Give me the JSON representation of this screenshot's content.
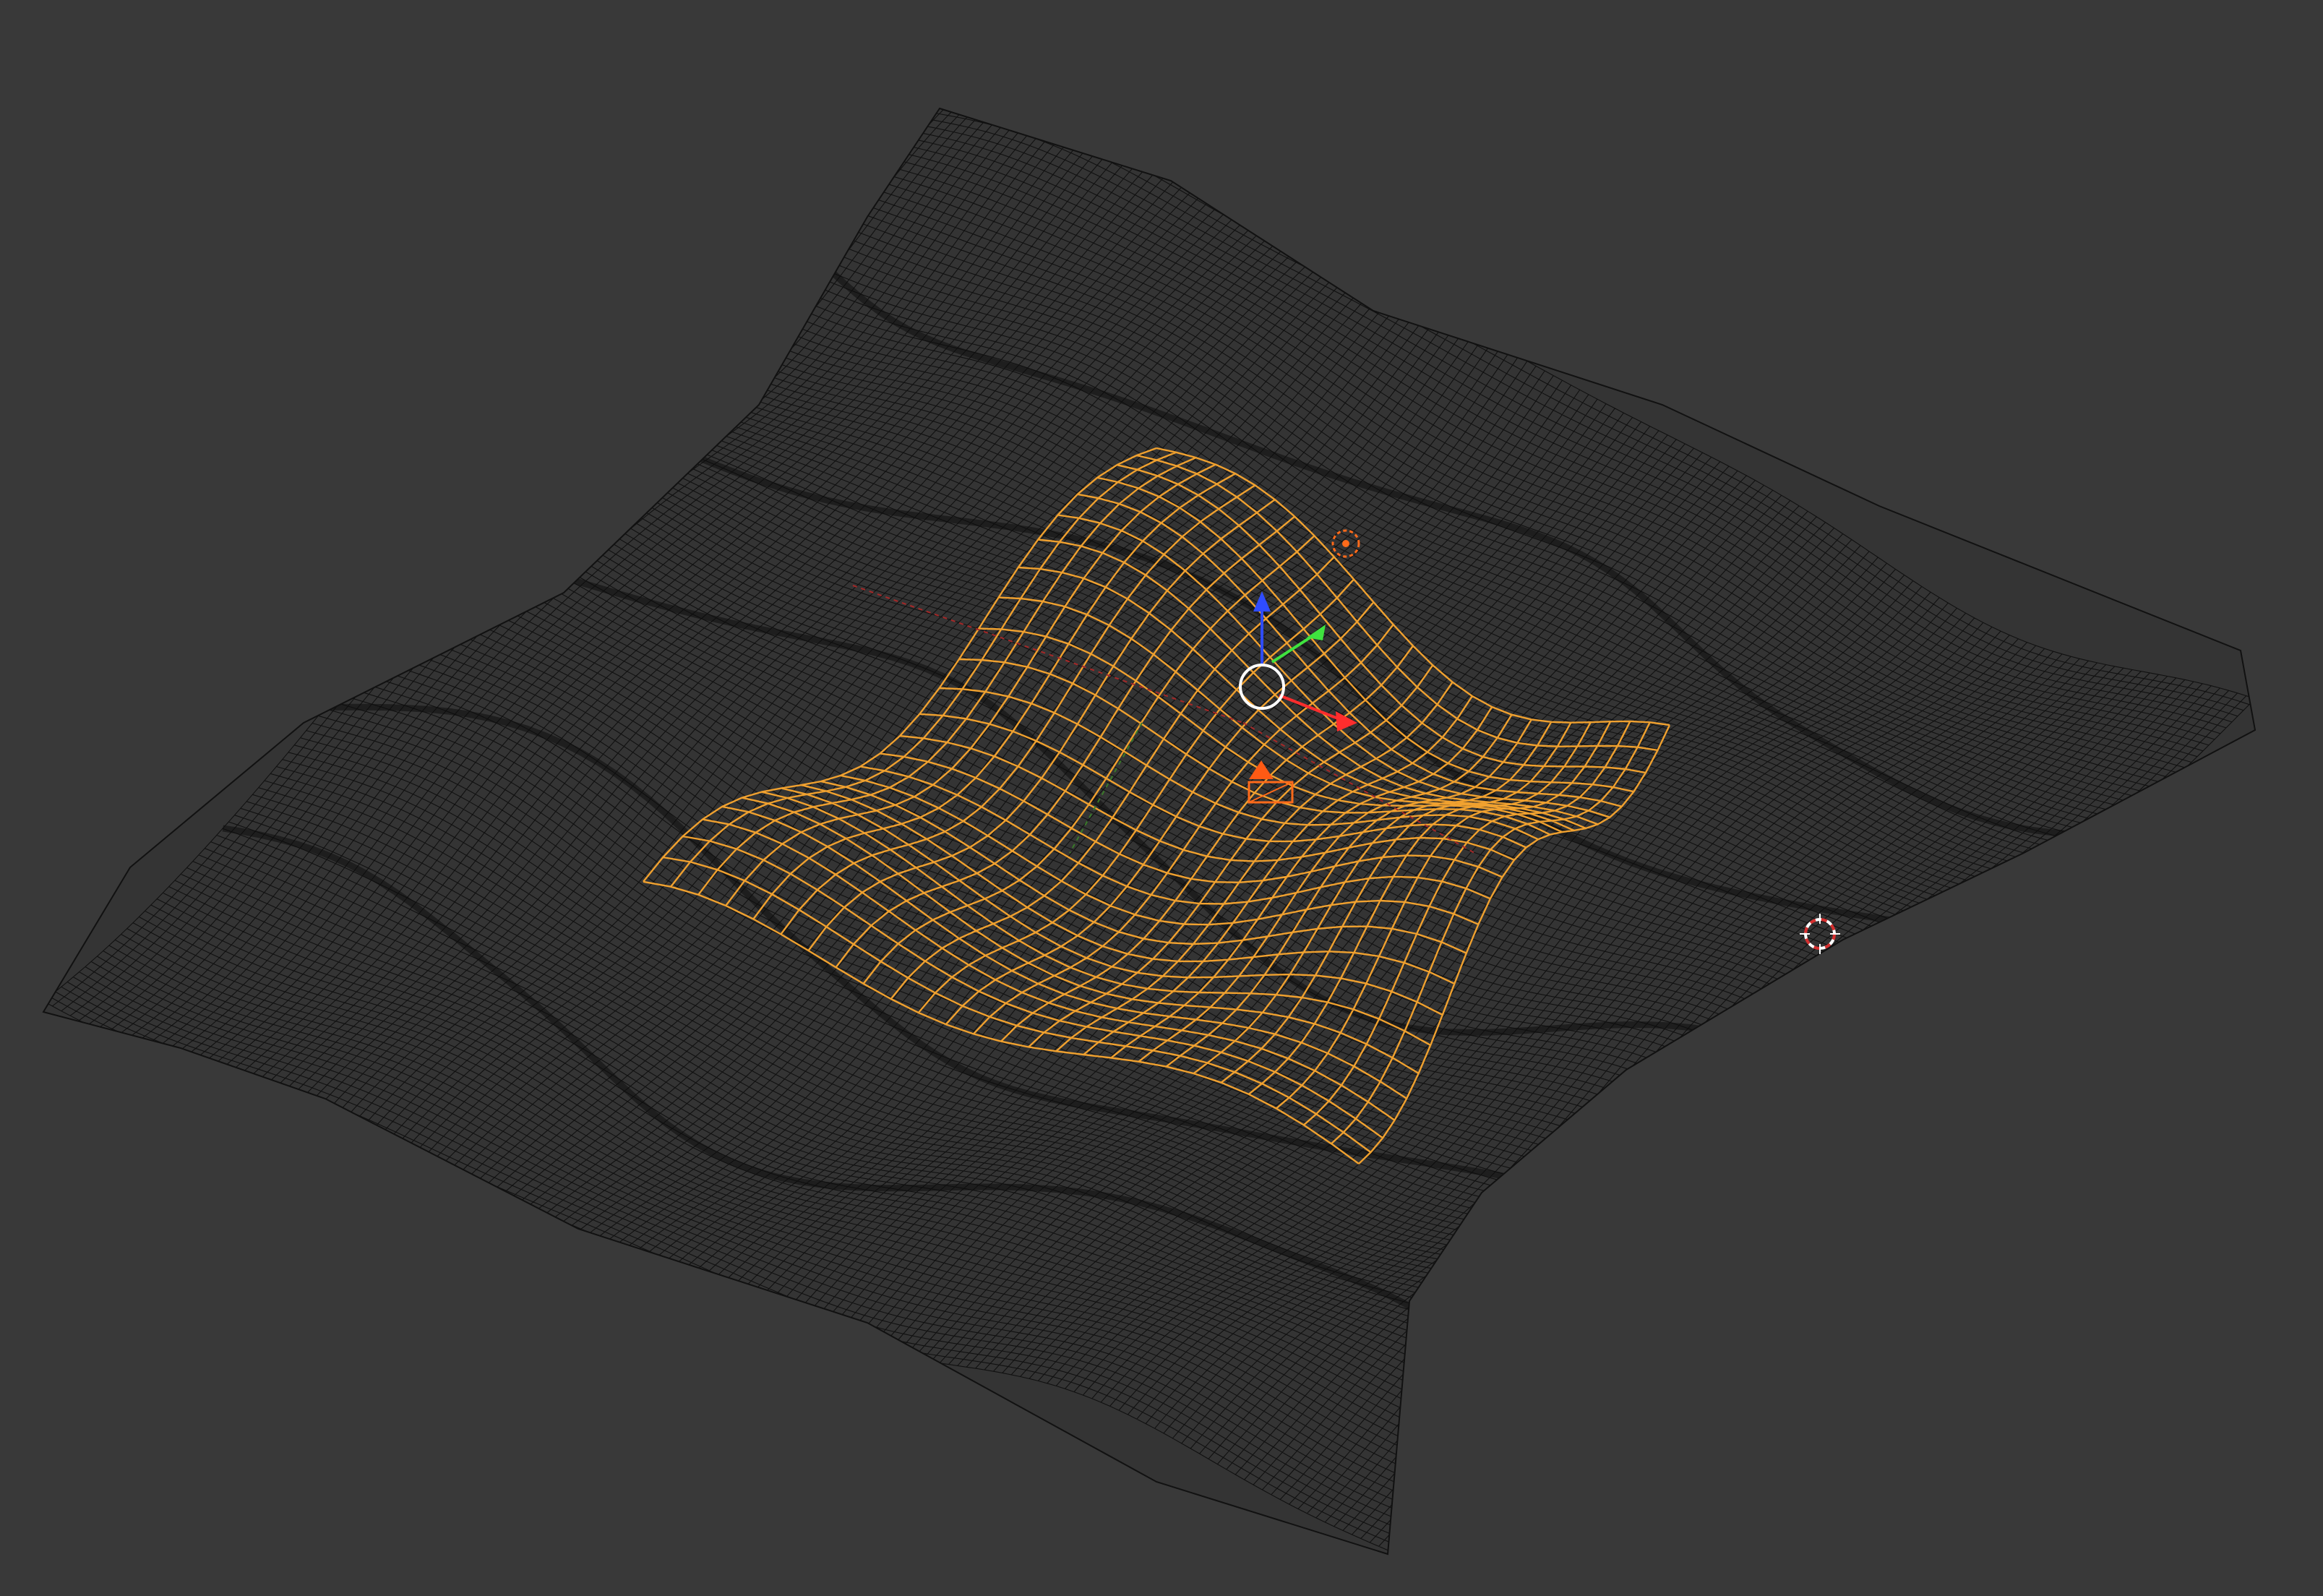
{
  "viewport": {
    "background_color": "#393939",
    "shading": "wireframe"
  },
  "objects": [
    {
      "name": "terrain",
      "type": "mesh",
      "selected": false,
      "wire_color": "#0a0a0a"
    },
    {
      "name": "selected-terrain-patch",
      "type": "mesh",
      "selected": true,
      "wire_color": "#f0a12f"
    },
    {
      "name": "camera",
      "type": "camera",
      "selected": true,
      "color": "#ff6a1a"
    },
    {
      "name": "light",
      "type": "light",
      "selected": true,
      "color": "#ff6a1a"
    },
    {
      "name": "3d-cursor",
      "type": "cursor",
      "colors": [
        "#d62f2f",
        "#ffffff"
      ]
    }
  ],
  "gizmo": {
    "x_axis_color": "#ff2d2d",
    "y_axis_color": "#3fe33f",
    "z_axis_color": "#2f4cff",
    "center_ring_color": "#ffffff"
  }
}
